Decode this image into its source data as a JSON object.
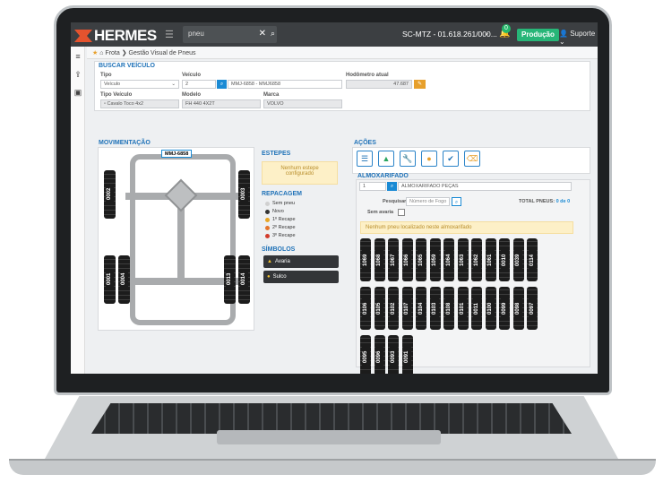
{
  "app": {
    "logo_text": "HERMES",
    "search_value": "pneu",
    "company": "SC-MTZ - 01.618.261/000...",
    "notification_count": "0",
    "environment": "Produção",
    "user": "Suporte"
  },
  "breadcrumb": {
    "root": "Frota",
    "page": "Gestão Visual de Pneus"
  },
  "buscar": {
    "title": "BUSCAR VEÍCULO",
    "tipo_label": "Tipo",
    "tipo_value": "Veículo",
    "veiculo_label": "Veículo",
    "veiculo_id": "2",
    "veiculo_desc": "MMJ-6858 - MMJ6858",
    "hodometro_label": "Hodômetro atual",
    "hodometro_value": "47.687",
    "tipo_veiculo_label": "Tipo Veículo",
    "tipo_veiculo_value": "Cavalo Toco 4x2",
    "modelo_label": "Modelo",
    "modelo_value": "FH 440 4X2T",
    "marca_label": "Marca",
    "marca_value": "VOLVO"
  },
  "movimentacao": {
    "title": "MOVIMENTAÇÃO",
    "plate": "MMJ-6858",
    "tires_left": [
      "0002",
      "0001",
      "0004"
    ],
    "tires_right": [
      "0003",
      "0013",
      "0014"
    ]
  },
  "estepes": {
    "title": "ESTEPES",
    "message": "Nenhum estepe configurado"
  },
  "repacagem": {
    "title": "REPACAGEM",
    "items": [
      {
        "label": "Sem pneu",
        "color": "#d0d0d0"
      },
      {
        "label": "Novo",
        "color": "#333333"
      },
      {
        "label": "1º Recape",
        "color": "#e8a625"
      },
      {
        "label": "2º Recape",
        "color": "#e5752b"
      },
      {
        "label": "3º Recape",
        "color": "#d23c2c"
      }
    ]
  },
  "simbolos": {
    "title": "SÍMBOLOS",
    "avaria": "Avaria",
    "sulco": "Sulco"
  },
  "acoes": {
    "title": "AÇÕES"
  },
  "almoxarifado": {
    "title": "ALMOXARIFADO",
    "id": "1",
    "name": "ALMOXARIFADO PEÇAS",
    "pesquisar_label": "Pesquisar",
    "pesquisar_placeholder": "Número de Fogo",
    "sem_avaria_label": "Sem avaria",
    "total_label": "TOTAL PNEUS:",
    "total_value": "0",
    "total_sep": "de",
    "total_of": "0",
    "empty_message": "Nenhum pneu localizado neste almoxarifado",
    "row1": [
      "1069",
      "1068",
      "1067",
      "1066",
      "1065",
      "1059",
      "1064",
      "1063",
      "1062",
      "1061",
      "0010",
      "0039",
      "0114"
    ],
    "row2": [
      "0106",
      "0105",
      "0102",
      "0107",
      "0104",
      "0103",
      "0108",
      "0101",
      "0011",
      "0100",
      "0099",
      "0098",
      "0097"
    ],
    "row3": [
      "0095",
      "0096",
      "0093",
      "0091"
    ]
  }
}
